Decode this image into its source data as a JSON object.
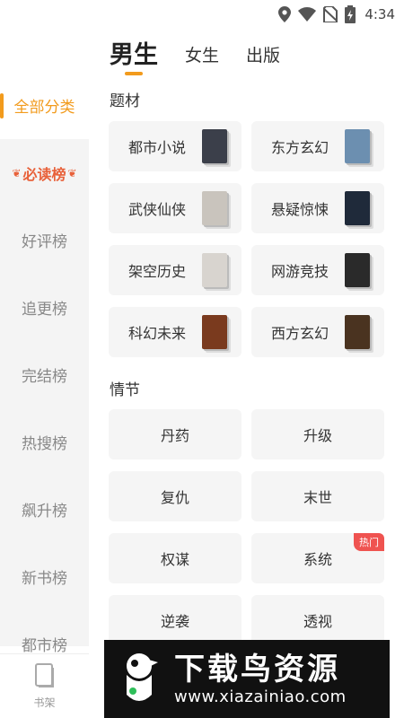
{
  "status": {
    "time": "4:34"
  },
  "tabs": [
    {
      "label": "男生"
    },
    {
      "label": "女生"
    },
    {
      "label": "出版"
    }
  ],
  "sidebar": {
    "items": [
      {
        "label": "全部分类"
      },
      {
        "label": "必读榜"
      },
      {
        "label": "好评榜"
      },
      {
        "label": "追更榜"
      },
      {
        "label": "完结榜"
      },
      {
        "label": "热搜榜"
      },
      {
        "label": "飙升榜"
      },
      {
        "label": "新书榜"
      },
      {
        "label": "都市榜"
      }
    ]
  },
  "bottom_nav": {
    "bookshelf_label": "书架"
  },
  "sections": {
    "theme": {
      "title": "题材",
      "items": [
        {
          "label": "都市小说",
          "cover_color": "#3b3f4a"
        },
        {
          "label": "东方玄幻",
          "cover_color": "#6c8fb0"
        },
        {
          "label": "武侠仙侠",
          "cover_color": "#c9c4bd"
        },
        {
          "label": "悬疑惊悚",
          "cover_color": "#1f2a3a"
        },
        {
          "label": "架空历史",
          "cover_color": "#d8d4cf"
        },
        {
          "label": "网游竞技",
          "cover_color": "#2a2a2a"
        },
        {
          "label": "科幻未来",
          "cover_color": "#7a3a1e"
        },
        {
          "label": "西方玄幻",
          "cover_color": "#4a3320"
        }
      ]
    },
    "plot": {
      "title": "情节",
      "items": [
        {
          "label": "丹药"
        },
        {
          "label": "升级"
        },
        {
          "label": "复仇"
        },
        {
          "label": "末世"
        },
        {
          "label": "权谋"
        },
        {
          "label": "系统",
          "badge": "热门"
        },
        {
          "label": "逆袭"
        },
        {
          "label": "透视"
        }
      ]
    }
  },
  "watermark": {
    "title": "下载鸟资源",
    "url": "www.xiazainiao.com"
  },
  "colors": {
    "accent": "#f29b1d",
    "special": "#e8613a",
    "hot": "#ef5350"
  }
}
